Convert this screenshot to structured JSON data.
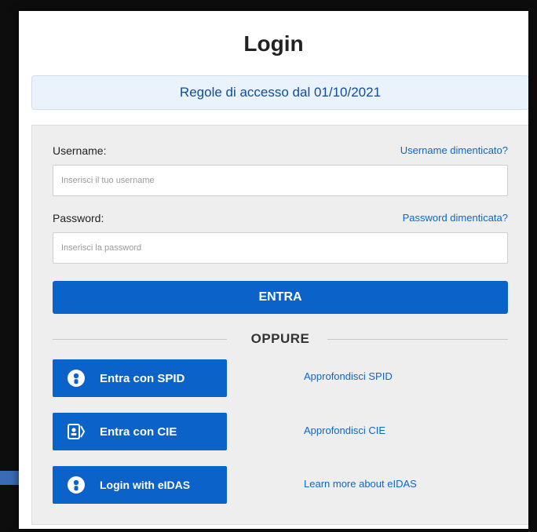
{
  "title": "Login",
  "notice": "Regole di accesso dal 01/10/2021",
  "username": {
    "label": "Username:",
    "forgot": "Username dimenticato?",
    "placeholder": "Inserisci il tuo username"
  },
  "password": {
    "label": "Password:",
    "forgot": "Password dimenticata?",
    "placeholder": "Inserisci la password"
  },
  "submit_label": "ENTRA",
  "divider_label": "OPPURE",
  "auth": {
    "spid": {
      "label": "Entra con SPID",
      "icon": "person-icon",
      "link": "Approfondisci SPID"
    },
    "cie": {
      "label": "Entra con CIE",
      "icon": "cie-card-icon",
      "link": "Approfondisci CIE"
    },
    "eidas": {
      "label": "Login with eIDAS",
      "icon": "person-icon",
      "link": "Learn more about eIDAS"
    }
  },
  "colors": {
    "primary": "#0b63c9",
    "link": "#0e67c8",
    "notice_bg": "#eaf2fb",
    "panel_bg": "#eeeeee"
  }
}
